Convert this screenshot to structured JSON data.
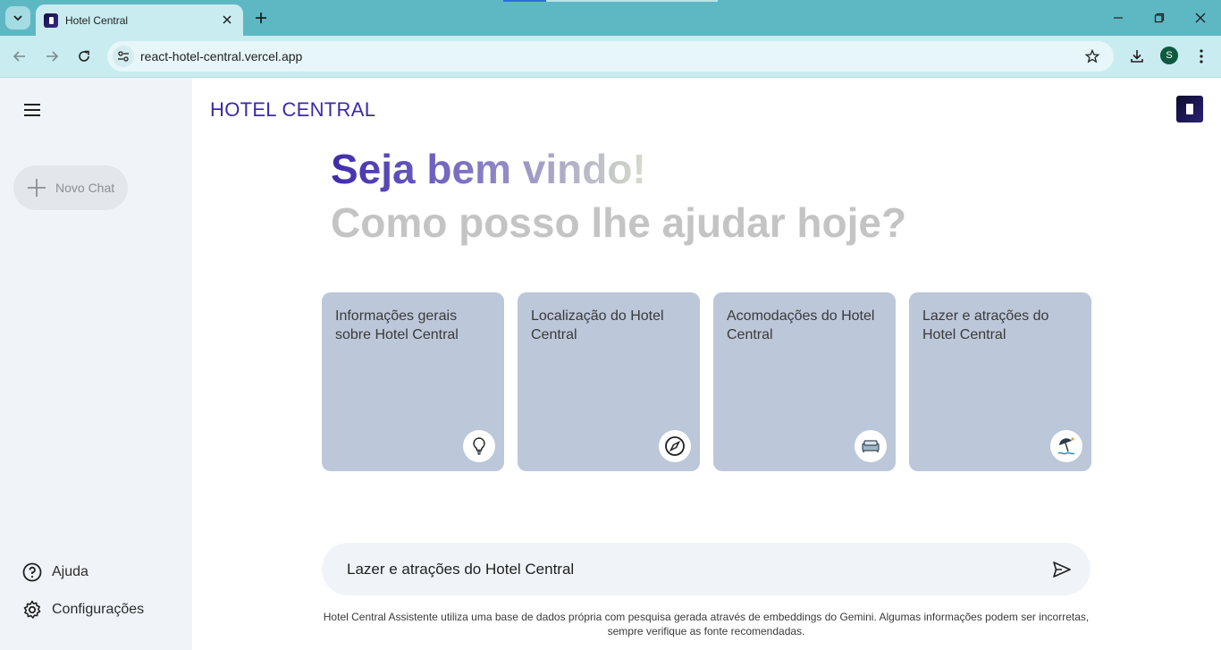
{
  "browser": {
    "tab_title": "Hotel Central",
    "url": "react-hotel-central.vercel.app",
    "profile_initial": "S"
  },
  "sidebar": {
    "new_chat_label": "Novo Chat",
    "items": [
      {
        "label": "Ajuda",
        "icon": "help-circle-icon"
      },
      {
        "label": "Configurações",
        "icon": "gear-icon"
      }
    ]
  },
  "header": {
    "brand": "HOTEL CENTRAL"
  },
  "greeting": {
    "line1": "Seja bem vindo!",
    "line2": "Como posso lhe ajudar hoje?"
  },
  "cards": [
    {
      "text": "Informações gerais sobre Hotel Central",
      "icon": "lightbulb-icon"
    },
    {
      "text": "Localização do Hotel Central",
      "icon": "compass-icon"
    },
    {
      "text": "Acomodações do Hotel Central",
      "icon": "bed-icon"
    },
    {
      "text": "Lazer e atrações do Hotel Central",
      "icon": "beach-icon"
    }
  ],
  "prompt": {
    "value": "Lazer e atrações do Hotel Central"
  },
  "disclaimer": "Hotel Central Assistente utiliza uma base de dados própria com pesquisa gerada através de embeddings do Gemini. Algumas informações podem ser incorretas, sempre verifique as fonte recomendadas.",
  "colors": {
    "brand": "#3b2aa6",
    "card": "#bcc7d9",
    "sidebar": "#f0f4f9",
    "chrome": "#5eb8c4"
  }
}
